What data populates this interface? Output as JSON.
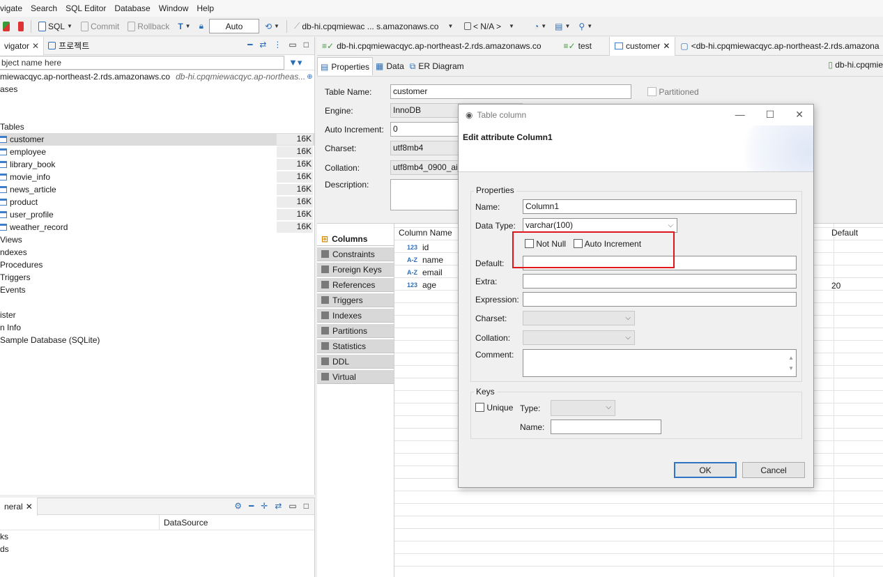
{
  "menu": [
    "vigate",
    "Search",
    "SQL Editor",
    "Database",
    "Window",
    "Help"
  ],
  "toolbar": {
    "sql": "SQL",
    "commit": "Commit",
    "rollback": "Rollback",
    "mode": "Auto",
    "connection": "db-hi.cpqmiewac ... s.amazonaws.co",
    "schema": "< N/A >"
  },
  "navigator": {
    "tab1": "vigator",
    "tab2": "프로젝트",
    "filter_placeholder": "bject name here",
    "connection": "miewacqyc.ap-northeast-2.rds.amazonaws.co",
    "connection_hint": "db-hi.cpqmiewacqyc.ap-northeas...",
    "databases": "ases",
    "tables_label": "Tables",
    "tables": [
      {
        "name": "customer",
        "size": "16K"
      },
      {
        "name": "employee",
        "size": "16K"
      },
      {
        "name": "library_book",
        "size": "16K"
      },
      {
        "name": "movie_info",
        "size": "16K"
      },
      {
        "name": "news_article",
        "size": "16K"
      },
      {
        "name": "product",
        "size": "16K"
      },
      {
        "name": "user_profile",
        "size": "16K"
      },
      {
        "name": "weather_record",
        "size": "16K"
      }
    ],
    "others": [
      "Views",
      "ndexes",
      "Procedures",
      "Triggers",
      "Events"
    ],
    "extra": [
      "ister",
      "n Info",
      "Sample Database (SQLite)"
    ]
  },
  "bottom_panel": {
    "tab": "neral",
    "col2": "DataSource",
    "rows": [
      "ks",
      "ds"
    ]
  },
  "editor_tabs": [
    {
      "label": "db-hi.cpqmiewacqyc.ap-northeast-2.rds.amazonaws.co"
    },
    {
      "label": "test"
    },
    {
      "label": "customer"
    },
    {
      "label": "<db-hi.cpqmiewacqyc.ap-northeast-2.rds.amazona"
    }
  ],
  "subtabs": {
    "properties": "Properties",
    "data": "Data",
    "er": "ER Diagram",
    "right": "db-hi.cpqmie"
  },
  "table_props": {
    "table_name_label": "Table Name:",
    "table_name": "customer",
    "partitioned": "Partitioned",
    "engine_label": "Engine:",
    "engine": "InnoDB",
    "auto_inc_label": "Auto Increment:",
    "auto_inc": "0",
    "charset_label": "Charset:",
    "charset": "utf8mb4",
    "collation_label": "Collation:",
    "collation": "utf8mb4_0900_ai_",
    "description_label": "Description:"
  },
  "side_tabs": [
    "Columns",
    "Constraints",
    "Foreign Keys",
    "References",
    "Triggers",
    "Indexes",
    "Partitions",
    "Statistics",
    "DDL",
    "Virtual"
  ],
  "columns_grid": {
    "header": "Column Name",
    "default_header": "Default",
    "rows": [
      {
        "type": "123",
        "name": "id",
        "default": ""
      },
      {
        "type": "A-Z",
        "name": "name",
        "default": ""
      },
      {
        "type": "A-Z",
        "name": "email",
        "default": ""
      },
      {
        "type": "123",
        "name": "age",
        "default": "20"
      }
    ]
  },
  "dialog": {
    "title": "Table column",
    "heading": "Edit attribute Column1",
    "properties_group": "Properties",
    "name_label": "Name:",
    "name": "Column1",
    "datatype_label": "Data Type:",
    "datatype": "varchar(100)",
    "not_null": "Not Null",
    "auto_increment": "Auto Increment",
    "default_label": "Default:",
    "extra_label": "Extra:",
    "expression_label": "Expression:",
    "charset_label": "Charset:",
    "collation_label": "Collation:",
    "comment_label": "Comment:",
    "keys_group": "Keys",
    "unique": "Unique",
    "type_label": "Type:",
    "keyname_label": "Name:",
    "ok": "OK",
    "cancel": "Cancel"
  },
  "colors": {
    "accent": "#2f73c4",
    "highlight": "#e0141b"
  }
}
